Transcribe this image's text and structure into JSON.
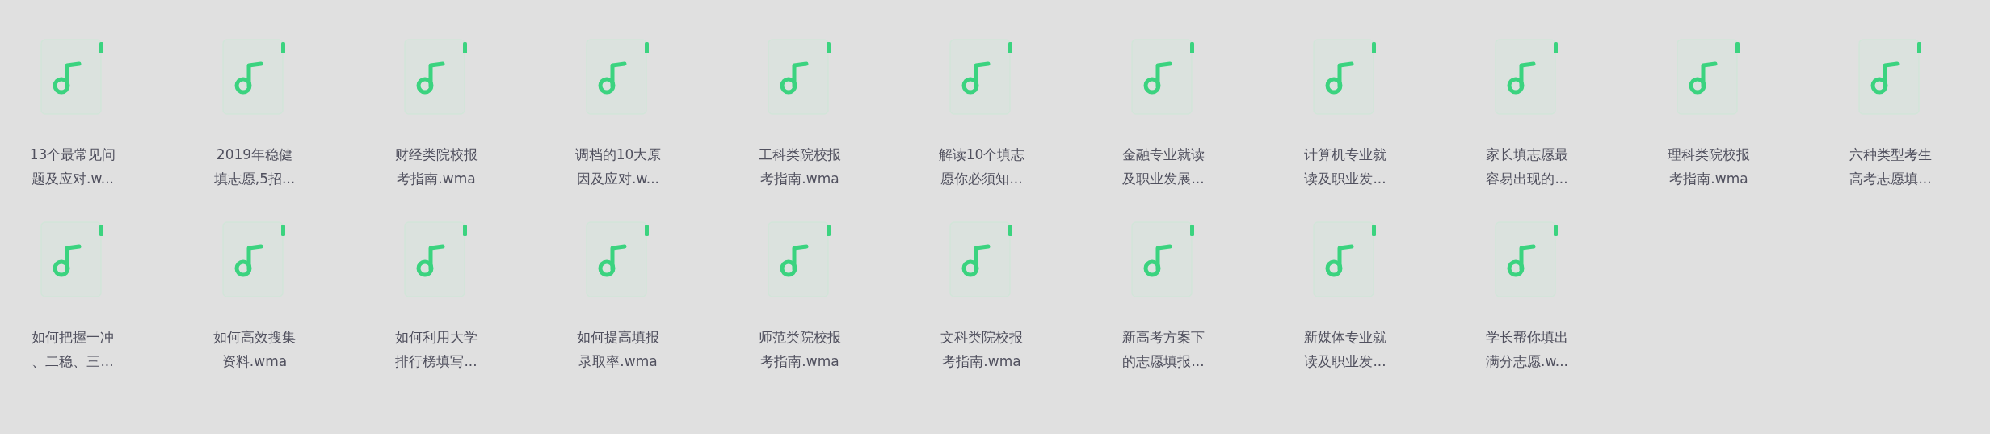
{
  "files": [
    {
      "lines": [
        "13个最常见问",
        "题及应对.w..."
      ]
    },
    {
      "lines": [
        "2019年稳健",
        "填志愿,5招..."
      ]
    },
    {
      "lines": [
        "财经类院校报",
        "考指南.wma"
      ]
    },
    {
      "lines": [
        "调档的10大原",
        "因及应对.w..."
      ]
    },
    {
      "lines": [
        "工科类院校报",
        "考指南.wma"
      ]
    },
    {
      "lines": [
        "解读10个填志",
        "愿你必须知..."
      ]
    },
    {
      "lines": [
        "金融专业就读",
        "及职业发展..."
      ]
    },
    {
      "lines": [
        "计算机专业就",
        "读及职业发..."
      ]
    },
    {
      "lines": [
        "家长填志愿最",
        "容易出现的..."
      ]
    },
    {
      "lines": [
        "理科类院校报",
        "考指南.wma"
      ]
    },
    {
      "lines": [
        "六种类型考生",
        "高考志愿填..."
      ]
    },
    {
      "lines": [
        "如何把握一冲",
        "、二稳、三..."
      ]
    },
    {
      "lines": [
        "如何高效搜集",
        "资料.wma"
      ]
    },
    {
      "lines": [
        "如何利用大学",
        "排行榜填写..."
      ]
    },
    {
      "lines": [
        "如何提高填报",
        "录取率.wma"
      ]
    },
    {
      "lines": [
        "师范类院校报",
        "考指南.wma"
      ]
    },
    {
      "lines": [
        "文科类院校报",
        "考指南.wma"
      ]
    },
    {
      "lines": [
        "新高考方案下",
        "的志愿填报..."
      ]
    },
    {
      "lines": [
        "新媒体专业就",
        "读及职业发..."
      ]
    },
    {
      "lines": [
        "学长帮你填出",
        "满分志愿.w..."
      ]
    }
  ]
}
